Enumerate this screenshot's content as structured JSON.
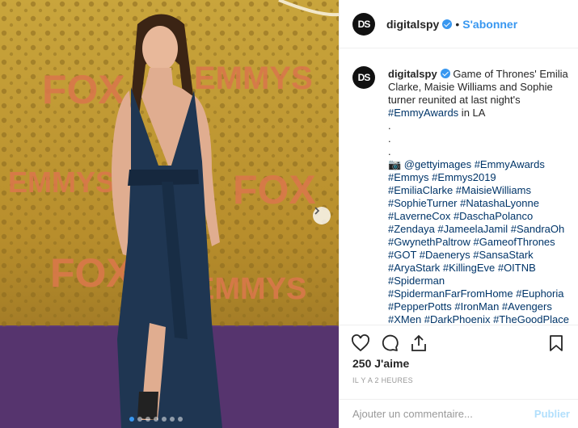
{
  "photo": {
    "alt": "Emilia Clarke at the Emmys",
    "backdrop_words": [
      "FOX",
      "EMMYS"
    ],
    "slide_count": 7,
    "active_slide": 1
  },
  "header": {
    "avatar_text": "DS",
    "username": "digitalspy",
    "separator": "•",
    "follow_label": "S'abonner"
  },
  "caption": {
    "avatar_text": "DS",
    "username": "digitalspy",
    "text_lines": [
      "Game of Thrones' Emilia",
      "Clarke, Maisie Williams and Sophie",
      "turner reunited at last night's"
    ],
    "tag_line_1_tag": "#EmmyAwards",
    "tag_line_1_rest": " in LA",
    "dots": [
      ".",
      ".",
      "."
    ],
    "camera_credit": "📷 @gettyimages #EmmyAwards",
    "hashtag_lines": [
      "#Emmys #Emmys2019",
      "#EmiliaClarke #MaisieWilliams",
      "#SophieTurner #NatashaLyonne",
      "#LaverneCox #DaschaPolanco",
      "#Zendaya #JameelaJamil #SandraOh",
      "#GwynethPaltrow #GameofThrones",
      "#GOT #Daenerys #SansaStark",
      "#AryaStark #KillingEve #OITNB",
      "#Spiderman",
      "#SpidermanFarFromHome #Euphoria",
      "#PepperPotts #IronMan #Avengers",
      "#XMen #DarkPhoenix #TheGoodPlace"
    ]
  },
  "actions": {
    "like_icon": "heart-icon",
    "comment_icon": "comment-icon",
    "share_icon": "share-icon",
    "save_icon": "bookmark-icon"
  },
  "likes_text": "250 J'aime",
  "timestamp": "IL Y A 2 HEURES",
  "comment_box": {
    "placeholder": "Ajouter un commentaire...",
    "publish_label": "Publier"
  },
  "colors": {
    "accent": "#3897f0",
    "link": "#003569",
    "publish_disabled": "#b2dffc"
  }
}
